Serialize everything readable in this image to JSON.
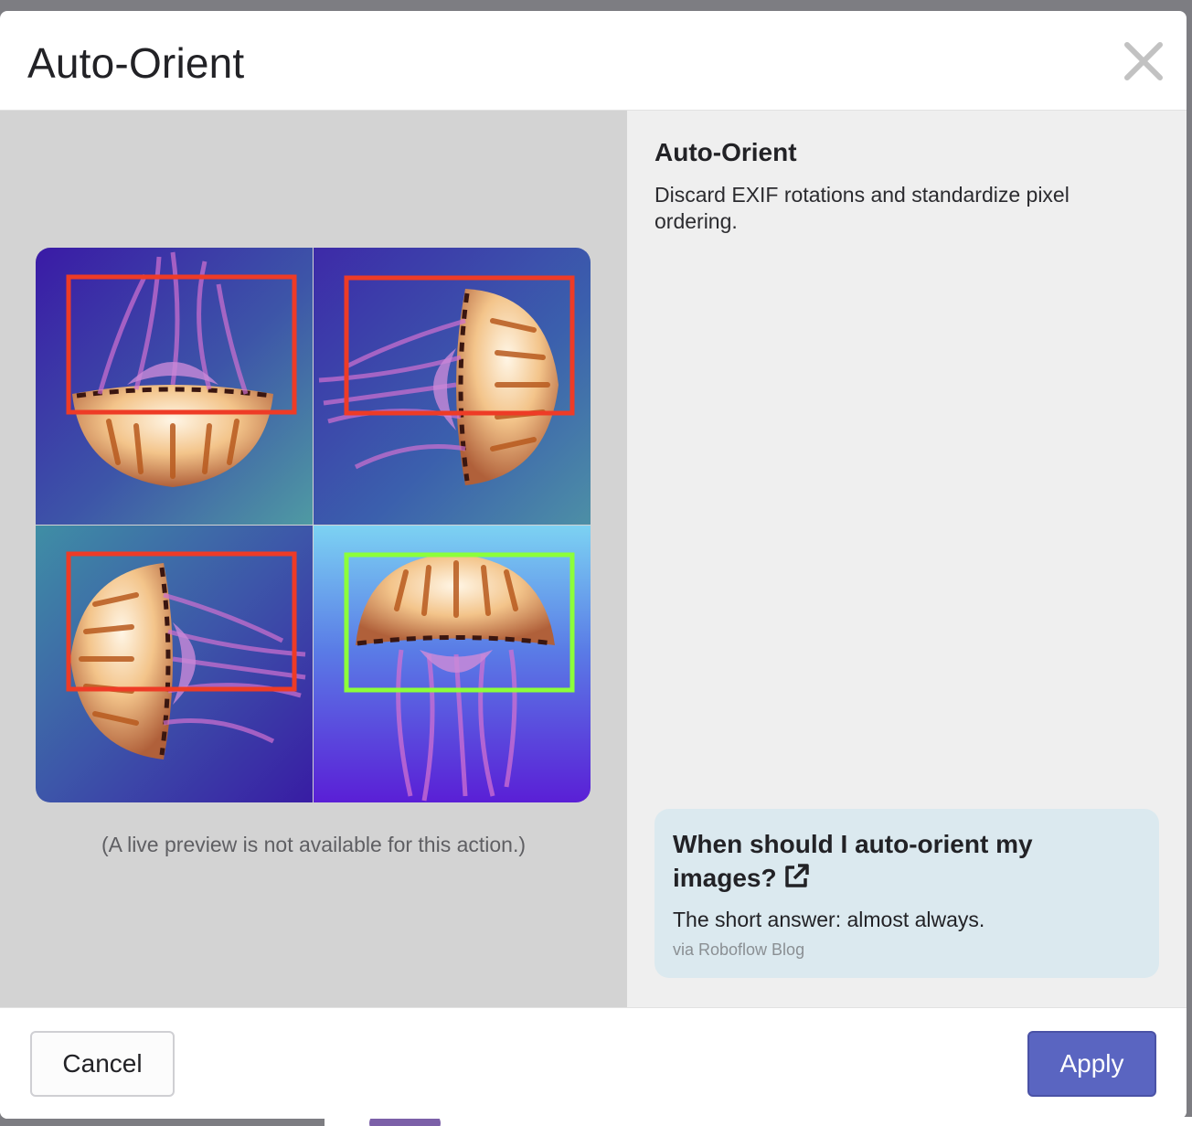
{
  "dialog": {
    "title": "Auto-Orient",
    "close_icon": "close-icon"
  },
  "preview": {
    "image_description": "four-orientation-jellyfish-grid",
    "caption": "(A live preview is not available for this action.)",
    "box_colors": {
      "incorrect": "#ee3b26",
      "correct": "#8cff3a"
    }
  },
  "info": {
    "title": "Auto-Orient",
    "description": "Discard EXIF rotations and standardize pixel ordering."
  },
  "help_card": {
    "title": "When should I auto-orient my images?",
    "icon": "external-link-icon",
    "text": "The short answer: almost always.",
    "source": "via Roboflow Blog"
  },
  "footer": {
    "cancel_label": "Cancel",
    "apply_label": "Apply"
  },
  "colors": {
    "accent": "#5a65c1",
    "preview_bg": "#d3d3d3",
    "info_bg": "#efefef",
    "card_bg": "#dbe9ef"
  }
}
